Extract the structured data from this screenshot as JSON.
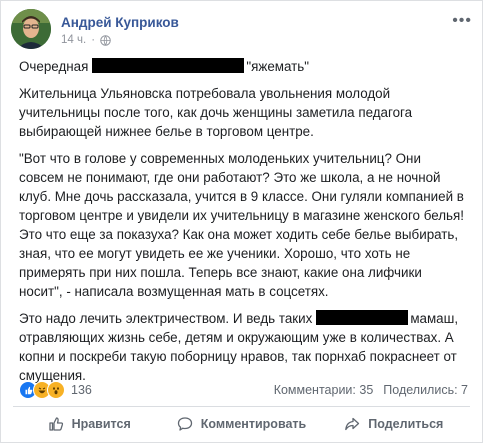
{
  "post": {
    "author": "Андрей Куприков",
    "time": "14 ч.",
    "more_label": "•••",
    "icons": {
      "avatar": "profile-photo",
      "audience": "globe-icon",
      "like": "thumbs-up-icon",
      "comment": "speech-bubble-icon",
      "share": "share-arrow-icon"
    },
    "body": {
      "p1": {
        "before": "Очередная",
        "after": "\"яжемать\""
      },
      "p2": "Жительница Ульяновска потребовала увольнения молодой учительницы после того, как дочь женщины заметила педагога выбирающей нижнее белье в торговом центре.",
      "p3": "\"Вот что в голове у современных молоденьких учительниц? Они совсем не понимают, где они работают? Это же школа, а не ночной клуб. Мне дочь рассказала, учится в 9 классе. Они гуляли компанией в торговом центре и увидели их учительницу в магазине женского белья! Это что еще за показуха? Как она может ходить себе белье выбирать, зная, что ее могут увидеть ее же ученики. Хорошо, что хоть не примерять при них пошла. Теперь все знают, какие она лифчики носит\", - написала возмущенная мать в соцсетях.",
      "p4": {
        "before": "Это надо лечить электричеством. И ведь таких",
        "after": "мамаш, отравляющих жизнь себе, детям и окружающим уже в количествах. А копни и поскреби такую поборницу нравов, так порнхаб покраснеет от смущения."
      }
    },
    "reactions": {
      "types": [
        "like",
        "haha",
        "wow"
      ],
      "colors": {
        "like": "#1877f2",
        "haha": "#f7b125",
        "wow": "#f7b125"
      },
      "count": "136",
      "comments": "Комментарии: 35",
      "shares": "Поделились: 7"
    },
    "actions": {
      "like": "Нравится",
      "comment": "Комментировать",
      "share": "Поделиться"
    },
    "colors": {
      "author": "#385898",
      "text": "#1c1e21",
      "muted": "#606770",
      "redaction": "#000000"
    }
  }
}
